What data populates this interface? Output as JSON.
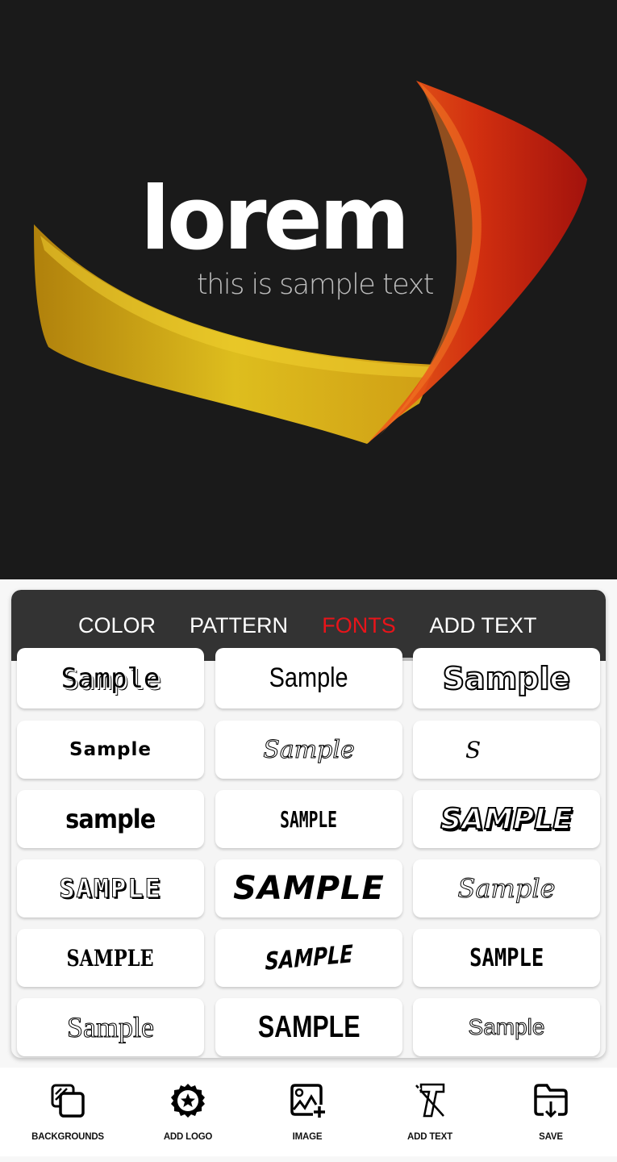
{
  "canvas": {
    "background_color": "#1a1a1a",
    "logo_title": "lorem",
    "logo_subtitle": "this is sample text",
    "swoosh_colors": {
      "yellow": "#e5c21a",
      "orange": "#e8541a",
      "red": "#b8170f"
    }
  },
  "tabs": [
    {
      "label": "COLOR",
      "active": false
    },
    {
      "label": "PATTERN",
      "active": false
    },
    {
      "label": "FONTS",
      "active": true
    },
    {
      "label": "ADD TEXT",
      "active": false
    }
  ],
  "accent_color": "#e8141a",
  "font_samples": [
    "Sample",
    "Sample",
    "Sample",
    "Sample",
    "Sample",
    "S",
    "sample",
    "SAMPLE",
    "SAMPLE",
    "SAMPLE",
    "SAMPLE",
    "Sample",
    "SAMPLE",
    "SAMPLE",
    "SAMPLE",
    "Sample",
    "SAMPLE",
    "Sample"
  ],
  "bottom_nav": [
    {
      "label": "BACKGROUNDS",
      "icon": "backgrounds-icon"
    },
    {
      "label": "ADD LOGO",
      "icon": "badge-star-icon"
    },
    {
      "label": "IMAGE",
      "icon": "image-add-icon"
    },
    {
      "label": "ADD TEXT",
      "icon": "text-icon"
    },
    {
      "label": "SAVE",
      "icon": "folder-download-icon"
    }
  ]
}
